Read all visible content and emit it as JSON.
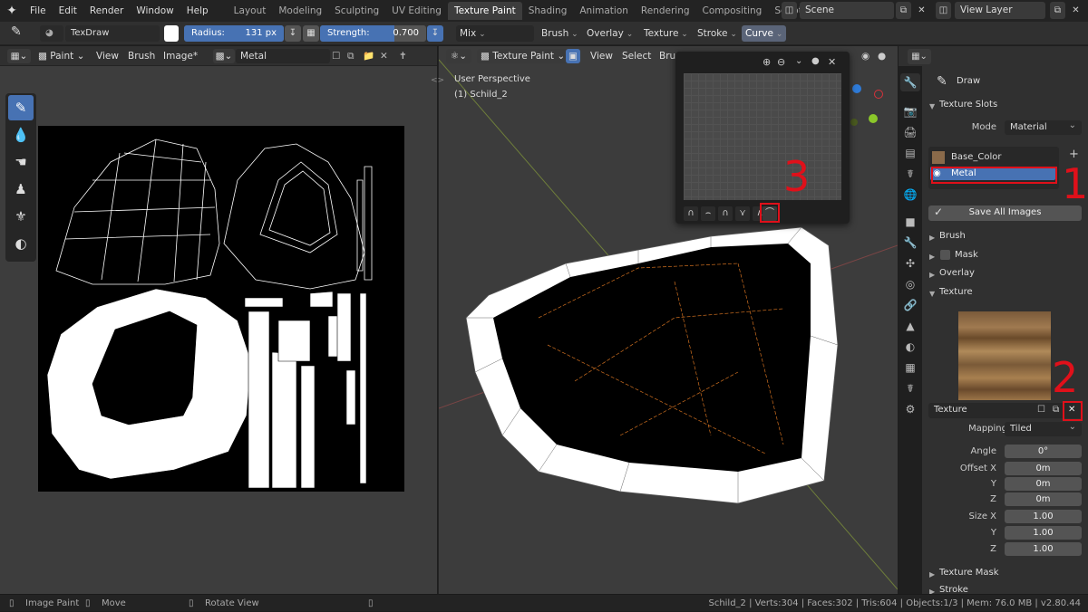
{
  "menu": [
    "File",
    "Edit",
    "Render",
    "Window",
    "Help"
  ],
  "workspaces": [
    "Layout",
    "Modeling",
    "Sculpting",
    "UV Editing",
    "Texture Paint",
    "Shading",
    "Animation",
    "Rendering",
    "Compositing",
    "Scripting"
  ],
  "active_workspace": "Texture Paint",
  "scene": "Scene",
  "view_layer": "View Layer",
  "tool_header": {
    "brush_name": "TexDraw",
    "radius_label": "Radius:",
    "radius_value": "131 px",
    "strength_label": "Strength:",
    "strength_value": "0.700",
    "strength_fraction": 0.7,
    "blend": "Mix",
    "brush": "Brush",
    "overlay": "Overlay",
    "texture": "Texture",
    "stroke": "Stroke",
    "curve": "Curve"
  },
  "image_editor": {
    "mode": "Paint",
    "view": "View",
    "brush": "Brush",
    "image": "Image*",
    "image_name": "Metal"
  },
  "viewport": {
    "mode": "Texture Paint",
    "view": "View",
    "select": "Select",
    "brush": "Brus",
    "perspective": "User Perspective",
    "object": "(1) Schild_2"
  },
  "properties": {
    "tool": "Draw",
    "texture_slots": "Texture Slots",
    "mode_label": "Mode",
    "mode_value": "Material",
    "slots": [
      "Base_Color",
      "Metal"
    ],
    "save_all": "Save All Images",
    "sections": [
      "Brush",
      "Mask",
      "Overlay",
      "Texture"
    ],
    "texture_name": "Texture",
    "mapping_label": "Mapping",
    "mapping_value": "Tiled",
    "angle_label": "Angle",
    "angle_value": "0°",
    "offset_x_label": "Offset X",
    "offset_x": "0m",
    "offset_y_label": "Y",
    "offset_y": "0m",
    "offset_z_label": "Z",
    "offset_z": "0m",
    "size_x_label": "Size X",
    "size_x": "1.00",
    "size_y_label": "Y",
    "size_y": "1.00",
    "size_z_label": "Z",
    "size_z": "1.00",
    "texture_mask": "Texture Mask",
    "stroke": "Stroke"
  },
  "annotations": [
    "1",
    "2",
    "3"
  ],
  "status": {
    "image_paint": "Image Paint",
    "move": "Move",
    "rotate": "Rotate View",
    "info": "Schild_2 | Verts:304 | Faces:302 | Tris:604 | Objects:1/3 | Mem: 76.0 MB | v2.80.44"
  },
  "colors": {
    "accent": "#4772b3",
    "annotation": "#e0101a",
    "background": "#303030"
  }
}
